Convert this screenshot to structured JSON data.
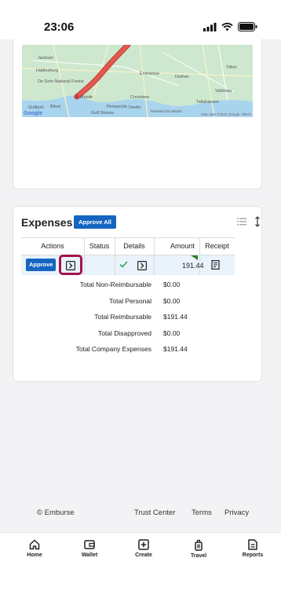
{
  "status_bar": {
    "time": "23:06"
  },
  "map": {
    "labels": [
      "Jackson",
      "Enterprise",
      "Dothan",
      "Tifton",
      "Mobile",
      "Pensacola",
      "Destin",
      "Crestview",
      "Panama City Beach",
      "Valdosta",
      "Gulfport",
      "Biloxi",
      "Gulf Shores",
      "Tallahassee",
      "Hattiesburg",
      "De Soto National Forest"
    ],
    "attribution": "Map data ©2024 Google, INEGI",
    "logo": "Google"
  },
  "expenses": {
    "title": "Expenses",
    "approve_all_label": "Approve All",
    "columns": [
      "Actions",
      "Status",
      "Details",
      "Amount",
      "Receipt"
    ],
    "row": {
      "approve_label": "Approve",
      "amount": "191.44"
    },
    "totals": [
      {
        "label": "Total Non-Reimbursable",
        "value": "$0.00"
      },
      {
        "label": "Total Personal",
        "value": "$0.00"
      },
      {
        "label": "Total Reimbursable",
        "value": "$191.44"
      },
      {
        "label": "Total Disapproved",
        "value": "$0.00"
      },
      {
        "label": "Total Company Expenses",
        "value": "$191.44"
      }
    ]
  },
  "footer": {
    "copyright": "© Emburse",
    "links": [
      "Trust Center",
      "Terms",
      "Privacy"
    ]
  },
  "bottom_nav": {
    "items": [
      {
        "label": "Home",
        "icon": "home-icon"
      },
      {
        "label": "Wallet",
        "icon": "wallet-icon"
      },
      {
        "label": "Create",
        "icon": "plus-square-icon"
      },
      {
        "label": "Travel",
        "icon": "luggage-icon"
      },
      {
        "label": "Reports",
        "icon": "report-icon"
      }
    ]
  },
  "colors": {
    "accent": "#1565c0",
    "highlight": "#a3134a",
    "route": "#e05a4e",
    "check": "#2e9e4a"
  }
}
